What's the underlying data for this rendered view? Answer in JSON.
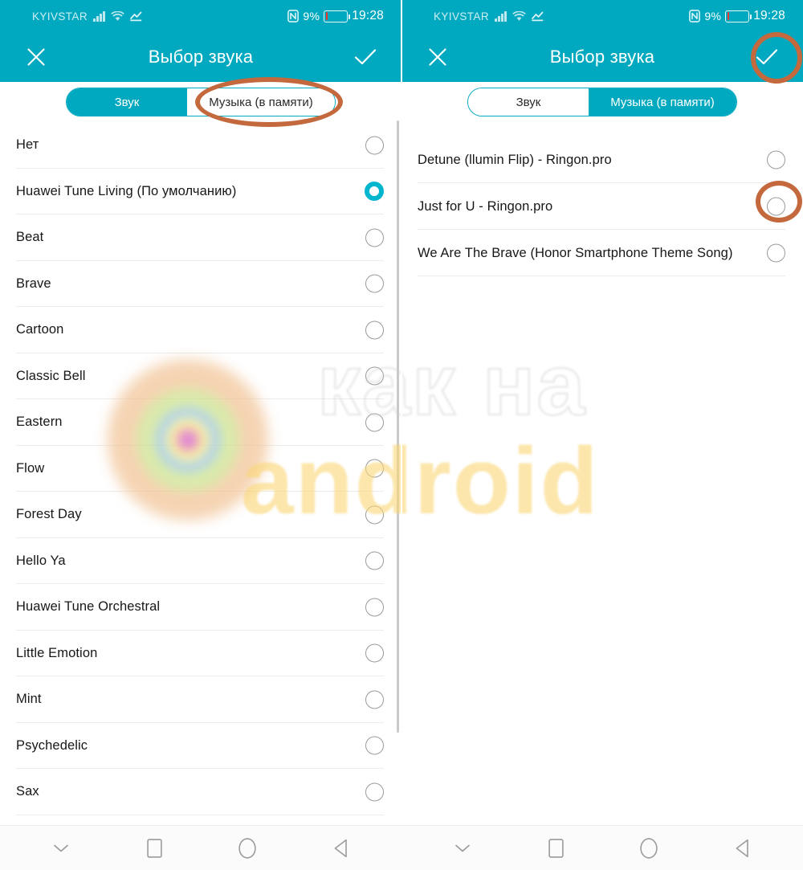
{
  "status_bar": {
    "carrier": "KYIVSTAR",
    "battery_percent": "9%",
    "clock": "19:28",
    "icons": [
      "signal-bars-icon",
      "wifi-icon",
      "data-transfer-icon",
      "nfc-icon",
      "battery-low-icon"
    ]
  },
  "app_bar": {
    "title": "Выбор звука",
    "close_icon": "close-x-icon",
    "confirm_icon": "checkmark-icon"
  },
  "tabs": {
    "sound": "Звук",
    "music": "Музыка (в памяти)"
  },
  "left_screen": {
    "active_tab": "Звук",
    "items": [
      {
        "label": "Нет",
        "selected": false
      },
      {
        "label": "Huawei Tune Living (По умолчанию)",
        "selected": true
      },
      {
        "label": "Beat",
        "selected": false
      },
      {
        "label": "Brave",
        "selected": false
      },
      {
        "label": "Cartoon",
        "selected": false
      },
      {
        "label": "Classic Bell",
        "selected": false
      },
      {
        "label": "Eastern",
        "selected": false
      },
      {
        "label": "Flow",
        "selected": false
      },
      {
        "label": "Forest Day",
        "selected": false
      },
      {
        "label": "Hello Ya",
        "selected": false
      },
      {
        "label": "Huawei Tune Orchestral",
        "selected": false
      },
      {
        "label": "Little Emotion",
        "selected": false
      },
      {
        "label": "Mint",
        "selected": false
      },
      {
        "label": "Psychedelic",
        "selected": false
      },
      {
        "label": "Sax",
        "selected": false
      }
    ]
  },
  "right_screen": {
    "active_tab": "Музыка (в памяти)",
    "items": [
      {
        "label": "Detune (llumin Flip) - Ringon.pro",
        "selected": false
      },
      {
        "label": "Just for U - Ringon.pro",
        "selected": false
      },
      {
        "label": "We Are The Brave (Honor Smartphone Theme Song)",
        "selected": false
      }
    ]
  },
  "nav_bar": {
    "buttons": [
      "hide-keyboard-chevron-icon",
      "recents-square-icon",
      "home-circle-icon",
      "back-triangle-icon"
    ]
  },
  "annotations": {
    "color": "#c4693d",
    "targets": [
      "music-tab-left",
      "confirm-checkmark-right",
      "radio-just-for-u-right"
    ]
  },
  "watermark": {
    "line1": "как на",
    "line2": "android"
  },
  "colors": {
    "accent_teal": "#00a9bf",
    "selected_radio": "#00b6cf",
    "annotation_orange": "#c4693d",
    "battery_low_red": "#e8392b"
  }
}
